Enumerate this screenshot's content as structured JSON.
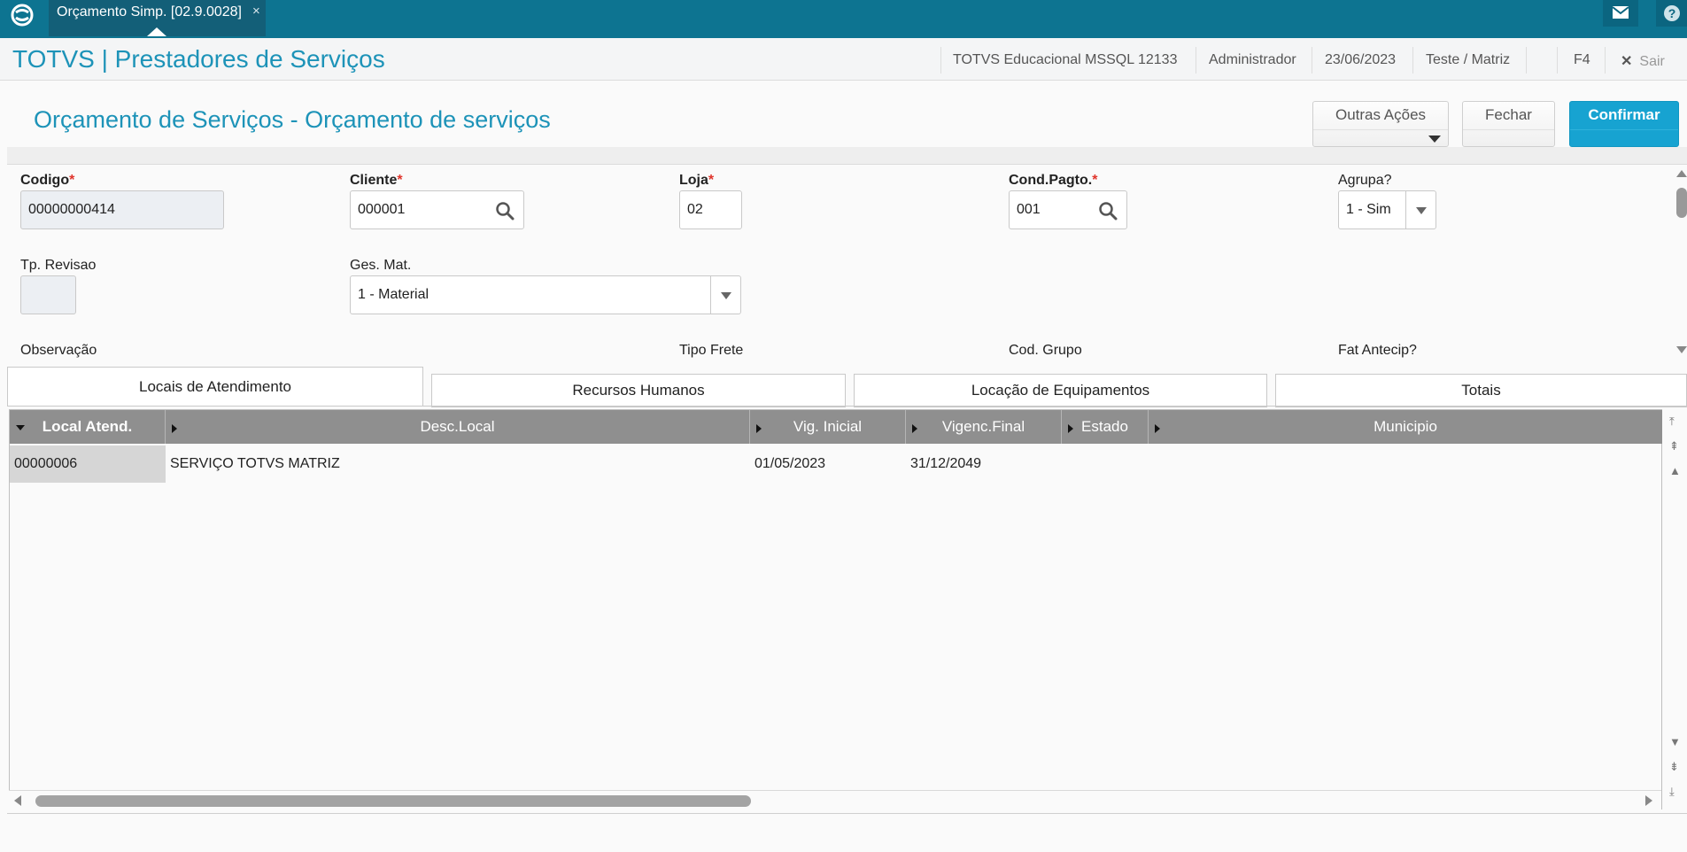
{
  "topbar": {
    "tab_label": "Orçamento Simp. [02.9.0028]",
    "tab_close": "×",
    "icons": [
      "totvs-logo-icon",
      "mail-icon",
      "help-icon"
    ]
  },
  "header": {
    "app_title": "TOTVS | Prestadores de Serviços",
    "environment": "TOTVS Educacional MSSQL 12133",
    "user": "Administrador",
    "date": "23/06/2023",
    "branch": "Teste / Matriz",
    "shortcut": "F4",
    "exit_label": "Sair"
  },
  "page": {
    "title": "Orçamento de Serviços - Orçamento de serviços",
    "actions": {
      "other": "Outras Ações",
      "close": "Fechar",
      "confirm": "Confirmar"
    }
  },
  "form": {
    "codigo": {
      "label": "Codigo",
      "value": "00000000414"
    },
    "cliente": {
      "label": "Cliente",
      "value": "000001"
    },
    "loja": {
      "label": "Loja",
      "value": "02"
    },
    "cond_pagto": {
      "label": "Cond.Pagto.",
      "value": "001"
    },
    "agrupa": {
      "label": "Agrupa?",
      "value": "1 - Sim"
    },
    "tp_revisao": {
      "label": "Tp. Revisao",
      "value": ""
    },
    "ges_mat": {
      "label": "Ges. Mat.",
      "value": "1 - Material"
    },
    "observacao": {
      "label": "Observação"
    },
    "tipo_frete": {
      "label": "Tipo Frete"
    },
    "cod_grupo": {
      "label": "Cod. Grupo"
    },
    "fat_antecip": {
      "label": "Fat Antecip?"
    },
    "required_mark": "*"
  },
  "tabs": [
    {
      "label": "Locais de Atendimento",
      "active": true
    },
    {
      "label": "Recursos Humanos",
      "active": false
    },
    {
      "label": "Locação de Equipamentos",
      "active": false
    },
    {
      "label": "Totais",
      "active": false
    }
  ],
  "grid": {
    "columns": [
      "Local Atend.",
      "Desc.Local",
      "Vig. Inicial",
      "Vigenc.Final",
      "Estado",
      "Municipio"
    ],
    "rows": [
      [
        "00000006",
        "SERVIÇO TOTVS MATRIZ",
        "01/05/2023",
        "31/12/2049",
        "",
        ""
      ]
    ]
  },
  "colors": {
    "topbar": "#0d7491",
    "accent": "#1d93b8",
    "confirm": "#17a3d1",
    "required": "#e0342b",
    "grid_header": "#8f8f8f"
  }
}
